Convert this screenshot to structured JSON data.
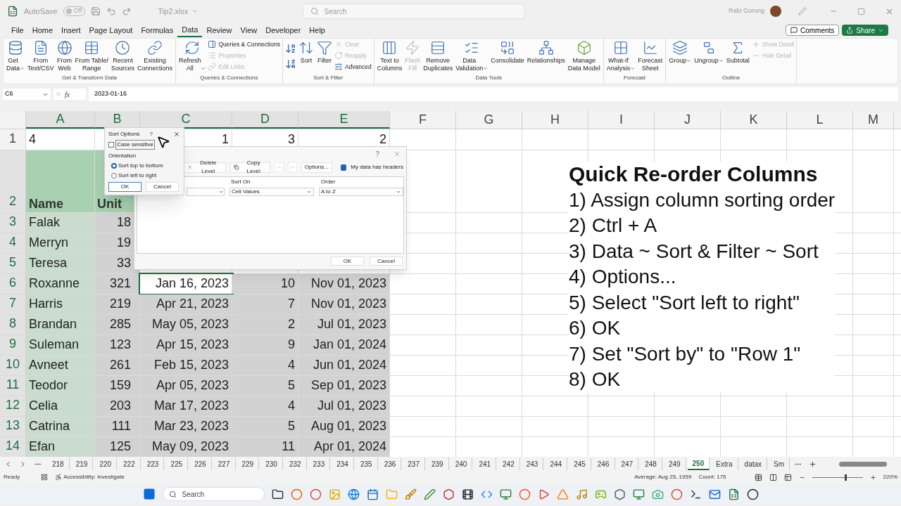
{
  "title_bar": {
    "autosave_label": "AutoSave",
    "autosave_toggle": {
      "label": "Off",
      "on": false
    },
    "file_name": "Tip2.xlsx",
    "search": {
      "placeholder": "Search"
    },
    "user_name": "Rabi Gurung"
  },
  "menu_tabs": [
    {
      "label": "File",
      "selected": false
    },
    {
      "label": "Home",
      "selected": false
    },
    {
      "label": "Insert",
      "selected": false
    },
    {
      "label": "Page Layout",
      "selected": false
    },
    {
      "label": "Formulas",
      "selected": false
    },
    {
      "label": "Data",
      "selected": true
    },
    {
      "label": "Review",
      "selected": false
    },
    {
      "label": "View",
      "selected": false
    },
    {
      "label": "Developer",
      "selected": false
    },
    {
      "label": "Help",
      "selected": false
    }
  ],
  "comments_button": "Comments",
  "share_button": "Share",
  "ribbon_groups": [
    {
      "title": "Get & Transform Data",
      "items": [
        {
          "kind": "large",
          "label": "Get\nData",
          "dropdown": true,
          "disabled": false
        },
        {
          "kind": "large",
          "label": "From\nText/CSV",
          "dropdown": false,
          "disabled": false
        },
        {
          "kind": "large",
          "label": "From\nWeb",
          "dropdown": false,
          "disabled": false
        },
        {
          "kind": "large",
          "label": "From Table/\nRange",
          "dropdown": false,
          "disabled": false
        },
        {
          "kind": "large",
          "label": "Recent\nSources",
          "dropdown": false,
          "disabled": false
        },
        {
          "kind": "large",
          "label": "Existing\nConnections",
          "dropdown": false,
          "disabled": false
        }
      ]
    },
    {
      "title": "Queries & Connections",
      "items": [
        {
          "kind": "large",
          "label": "Refresh\nAll",
          "dropdown": true,
          "disabled": false
        },
        {
          "kind": "stack",
          "items": [
            {
              "label": "Queries & Connections",
              "disabled": false
            },
            {
              "label": "Properties",
              "disabled": true
            },
            {
              "label": "Edit Links",
              "disabled": true
            }
          ]
        }
      ]
    },
    {
      "title": "Sort & Filter",
      "items": [
        {
          "kind": "sort_pair"
        },
        {
          "kind": "large",
          "label": "Sort",
          "dropdown": false,
          "disabled": false
        },
        {
          "kind": "large",
          "label": "Filter",
          "dropdown": false,
          "disabled": false
        },
        {
          "kind": "stack",
          "items": [
            {
              "label": "Clear",
              "disabled": true
            },
            {
              "label": "Reapply",
              "disabled": true
            },
            {
              "label": "Advanced",
              "disabled": false
            }
          ]
        }
      ]
    },
    {
      "title": "Data Tools",
      "items": [
        {
          "kind": "large",
          "label": "Text to\nColumns",
          "dropdown": false,
          "disabled": false
        },
        {
          "kind": "large",
          "label": "Flash\nFill",
          "dropdown": false,
          "disabled": true
        },
        {
          "kind": "large",
          "label": "Remove\nDuplicates",
          "dropdown": false,
          "disabled": false
        },
        {
          "kind": "large",
          "label": "Data\nValidation",
          "dropdown": true,
          "disabled": false
        },
        {
          "kind": "large",
          "label": "Consolidate",
          "dropdown": false,
          "disabled": false
        },
        {
          "kind": "large",
          "label": "Relationships",
          "dropdown": false,
          "disabled": false
        },
        {
          "kind": "large",
          "label": "Manage\nData Model",
          "dropdown": false,
          "disabled": false
        }
      ]
    },
    {
      "title": "Forecast",
      "items": [
        {
          "kind": "large",
          "label": "What-If\nAnalysis",
          "dropdown": true,
          "disabled": false
        },
        {
          "kind": "large",
          "label": "Forecast\nSheet",
          "dropdown": false,
          "disabled": false
        }
      ]
    },
    {
      "title": "Outline",
      "items": [
        {
          "kind": "large",
          "label": "Group",
          "dropdown": true,
          "disabled": false
        },
        {
          "kind": "large",
          "label": "Ungroup",
          "dropdown": true,
          "disabled": false
        },
        {
          "kind": "large",
          "label": "Subtotal",
          "dropdown": false,
          "disabled": false
        },
        {
          "kind": "stack",
          "items": [
            {
              "label": "Show Detail",
              "disabled": true
            },
            {
              "label": "Hide Detail",
              "disabled": true
            }
          ]
        }
      ]
    }
  ],
  "formula_bar": {
    "name_box": "C6",
    "fx_label": "fx",
    "formula": "2023-01-16"
  },
  "columns": [
    {
      "letter": "A",
      "selected": true
    },
    {
      "letter": "B",
      "selected": true
    },
    {
      "letter": "C",
      "selected": true
    },
    {
      "letter": "D",
      "selected": true
    },
    {
      "letter": "E",
      "selected": true
    },
    {
      "letter": "F",
      "selected": false
    },
    {
      "letter": "G",
      "selected": false
    },
    {
      "letter": "H",
      "selected": false
    },
    {
      "letter": "I",
      "selected": false
    },
    {
      "letter": "J",
      "selected": false
    },
    {
      "letter": "K",
      "selected": false
    },
    {
      "letter": "L",
      "selected": false
    },
    {
      "letter": "M",
      "selected": false
    }
  ],
  "rows": [
    {
      "number": "1",
      "kind": "order",
      "selected": false,
      "cells": [
        {
          "text": "4",
          "active": false
        },
        null,
        {
          "text": "1",
          "active": false
        },
        {
          "text": "3",
          "active": false
        },
        {
          "text": "2",
          "active": false
        }
      ]
    },
    {
      "number": "2",
      "kind": "header",
      "selected": true,
      "cells": [
        {
          "text": "Name",
          "active": false
        },
        {
          "text": "Unit",
          "active": false
        },
        null,
        null,
        null
      ]
    },
    {
      "number": "3",
      "kind": "data",
      "selected": true,
      "cells": [
        {
          "text": "Falak",
          "active": false
        },
        {
          "text": "18",
          "active": false
        },
        null,
        null,
        null
      ]
    },
    {
      "number": "4",
      "kind": "data",
      "selected": true,
      "cells": [
        {
          "text": "Merryn",
          "active": false
        },
        {
          "text": "19",
          "active": false
        },
        null,
        null,
        null
      ]
    },
    {
      "number": "5",
      "kind": "data",
      "selected": true,
      "cells": [
        {
          "text": "Teresa",
          "active": false
        },
        {
          "text": "33",
          "active": false
        },
        null,
        null,
        null
      ]
    },
    {
      "number": "6",
      "kind": "data",
      "selected": true,
      "cells": [
        {
          "text": "Roxanne",
          "active": false
        },
        {
          "text": "321",
          "active": false
        },
        {
          "text": "Jan 16, 2023",
          "active": true
        },
        {
          "text": "10",
          "active": false
        },
        {
          "text": "Nov 01, 2023",
          "active": false
        }
      ]
    },
    {
      "number": "7",
      "kind": "data",
      "selected": true,
      "cells": [
        {
          "text": "Harris",
          "active": false
        },
        {
          "text": "219",
          "active": false
        },
        {
          "text": "Apr 21, 2023",
          "active": false
        },
        {
          "text": "7",
          "active": false
        },
        {
          "text": "Nov 01, 2023",
          "active": false
        }
      ]
    },
    {
      "number": "8",
      "kind": "data",
      "selected": true,
      "cells": [
        {
          "text": "Brandan",
          "active": false
        },
        {
          "text": "285",
          "active": false
        },
        {
          "text": "May 05, 2023",
          "active": false
        },
        {
          "text": "2",
          "active": false
        },
        {
          "text": "Jul 01, 2023",
          "active": false
        }
      ]
    },
    {
      "number": "9",
      "kind": "data",
      "selected": true,
      "cells": [
        {
          "text": "Suleman",
          "active": false
        },
        {
          "text": "123",
          "active": false
        },
        {
          "text": "Apr 15, 2023",
          "active": false
        },
        {
          "text": "9",
          "active": false
        },
        {
          "text": "Jan 01, 2024",
          "active": false
        }
      ]
    },
    {
      "number": "10",
      "kind": "data",
      "selected": true,
      "cells": [
        {
          "text": "Avneet",
          "active": false
        },
        {
          "text": "261",
          "active": false
        },
        {
          "text": "Feb 15, 2023",
          "active": false
        },
        {
          "text": "4",
          "active": false
        },
        {
          "text": "Jun 01, 2024",
          "active": false
        }
      ]
    },
    {
      "number": "11",
      "kind": "data",
      "selected": true,
      "cells": [
        {
          "text": "Teodor",
          "active": false
        },
        {
          "text": "159",
          "active": false
        },
        {
          "text": "Apr 05, 2023",
          "active": false
        },
        {
          "text": "5",
          "active": false
        },
        {
          "text": "Sep 01, 2023",
          "active": false
        }
      ]
    },
    {
      "number": "12",
      "kind": "data",
      "selected": true,
      "cells": [
        {
          "text": "Celia",
          "active": false
        },
        {
          "text": "203",
          "active": false
        },
        {
          "text": "Mar 17, 2023",
          "active": false
        },
        {
          "text": "4",
          "active": false
        },
        {
          "text": "Jul 01, 2023",
          "active": false
        }
      ]
    },
    {
      "number": "13",
      "kind": "data",
      "selected": true,
      "cells": [
        {
          "text": "Catrina",
          "active": false
        },
        {
          "text": "111",
          "active": false
        },
        {
          "text": "Mar 23, 2023",
          "active": false
        },
        {
          "text": "5",
          "active": false
        },
        {
          "text": "Aug 01, 2023",
          "active": false
        }
      ]
    },
    {
      "number": "14",
      "kind": "data",
      "selected": true,
      "cells": [
        {
          "text": "Efan",
          "active": false
        },
        {
          "text": "125",
          "active": false
        },
        {
          "text": "May 09, 2023",
          "active": false
        },
        {
          "text": "11",
          "active": false
        },
        {
          "text": "Apr 01, 2024",
          "active": false
        }
      ]
    }
  ],
  "notes": {
    "title": "Quick Re-order Columns",
    "steps": [
      "1) Assign column sorting order",
      "2) Ctrl + A",
      "3) Data ~ Sort & Filter ~ Sort",
      "4) Options...",
      "5) Select \"Sort left to right\"",
      "6) OK",
      "7) Set \"Sort by\" to \"Row 1\"",
      "8) OK"
    ]
  },
  "sort_dialog": {
    "help": "?",
    "toolbar": [
      "Delete Level",
      "Copy Level",
      "Options..."
    ],
    "headers_checkbox": {
      "label": "My data has headers",
      "checked": true
    },
    "columns": [
      "Sort On",
      "Order"
    ],
    "level": {
      "sort_on": "Cell Values",
      "order": "A to Z"
    },
    "buttons": [
      "OK",
      "Cancel"
    ]
  },
  "sort_options": {
    "title": "Sort Options",
    "help": "?",
    "case_sensitive": {
      "label": "Case sensitive",
      "checked": false
    },
    "orientation_label": "Orientation",
    "orientations": [
      {
        "label": "Sort top to bottom",
        "selected": true
      },
      {
        "label": "Sort left to right",
        "selected": false
      }
    ],
    "buttons": [
      "OK",
      "Cancel"
    ]
  },
  "sheet_tabs": [
    {
      "label": "218",
      "selected": false
    },
    {
      "label": "219",
      "selected": false
    },
    {
      "label": "220",
      "selected": false
    },
    {
      "label": "222",
      "selected": false
    },
    {
      "label": "223",
      "selected": false
    },
    {
      "label": "225",
      "selected": false
    },
    {
      "label": "226",
      "selected": false
    },
    {
      "label": "227",
      "selected": false
    },
    {
      "label": "229",
      "selected": false
    },
    {
      "label": "230",
      "selected": false
    },
    {
      "label": "232",
      "selected": false
    },
    {
      "label": "233",
      "selected": false
    },
    {
      "label": "234",
      "selected": false
    },
    {
      "label": "235",
      "selected": false
    },
    {
      "label": "236",
      "selected": false
    },
    {
      "label": "237",
      "selected": false
    },
    {
      "label": "239",
      "selected": false
    },
    {
      "label": "240",
      "selected": false
    },
    {
      "label": "241",
      "selected": false
    },
    {
      "label": "242",
      "selected": false
    },
    {
      "label": "243",
      "selected": false
    },
    {
      "label": "244",
      "selected": false
    },
    {
      "label": "245",
      "selected": false
    },
    {
      "label": "246",
      "selected": false
    },
    {
      "label": "247",
      "selected": false
    },
    {
      "label": "248",
      "selected": false
    },
    {
      "label": "249",
      "selected": false
    },
    {
      "label": "250",
      "selected": true
    },
    {
      "label": "Extra",
      "selected": false
    },
    {
      "label": "datax",
      "selected": false
    },
    {
      "label": "Sm",
      "selected": false
    }
  ],
  "status_bar": {
    "mode": "Ready",
    "accessibility": "Accessibility: Investigate",
    "average": "Average: Aug 25, 1959",
    "count": "Count: 175",
    "zoom": {
      "label": "220%",
      "level": 0.65
    }
  },
  "taskbar": {
    "search": {
      "placeholder": "Search"
    }
  }
}
